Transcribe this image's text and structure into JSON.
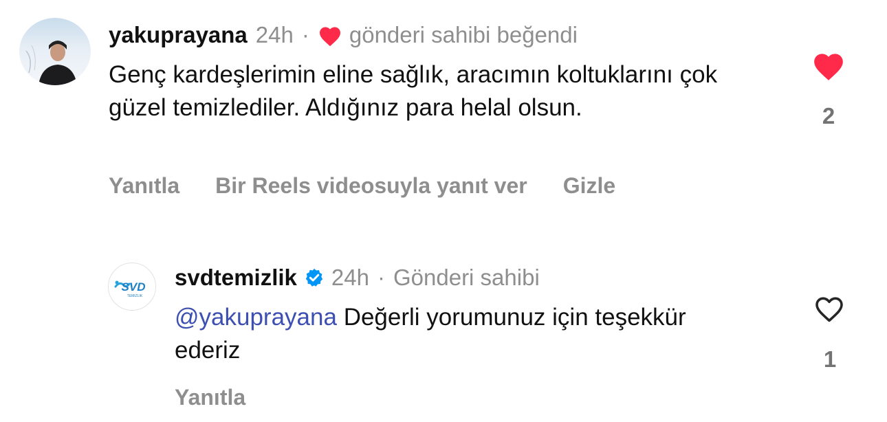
{
  "comments": [
    {
      "username": "yakuprayana",
      "time": "24h",
      "meta_sep": "·",
      "liked_by_author_text": "gönderi sahibi beğendi",
      "text": "Genç kardeşlerimin eline sağlık, aracımın koltuklarını çok güzel temizlediler. Aldığınız para helal olsun.",
      "actions": {
        "reply": "Yanıtla",
        "reels_reply": "Bir Reels videosuyla yanıt ver",
        "hide": "Gizle"
      },
      "liked": true,
      "like_count": "2",
      "colors": {
        "heart": "#ff2a4a"
      }
    },
    {
      "username": "svdtemizlik",
      "verified": true,
      "time": "24h",
      "meta_sep": "·",
      "author_label": "Gönderi sahibi",
      "mention": "@yakuprayana",
      "text": "Değerli yorumunuz için teşekkür ederiz",
      "actions": {
        "reply": "Yanıtla"
      },
      "liked": false,
      "like_count": "1",
      "avatar_logo_text": "SVD",
      "avatar_logo_sub": "TEMIZLIK",
      "colors": {
        "verified": "#0095f6",
        "mention": "#3d4fb0",
        "logo": "#1d7fc4"
      }
    }
  ]
}
